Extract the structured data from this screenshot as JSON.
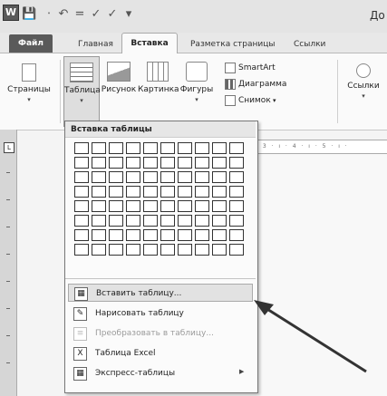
{
  "title_bar": {
    "app_logo": "W",
    "doc_title": "До"
  },
  "tabs": {
    "file": "Файл",
    "home": "Главная",
    "insert": "Вставка",
    "page_layout": "Разметка страницы",
    "references": "Ссылки"
  },
  "ribbon": {
    "pages": "Страницы",
    "table": "Таблица",
    "picture": "Рисунок",
    "clipart": "Картинка",
    "shapes": "Фигуры",
    "smartart": "SmartArt",
    "chart": "Диаграмма",
    "screenshot": "Снимок",
    "links": "Ссылки"
  },
  "table_menu": {
    "header": "Вставка таблицы",
    "grid": {
      "columns": 10,
      "rows": 8
    },
    "items": [
      {
        "label": "Вставить таблицу...",
        "icon": "insert-table-icon",
        "enabled": true,
        "highlighted": true
      },
      {
        "label": "Нарисовать таблицу",
        "icon": "draw-table-icon",
        "enabled": true
      },
      {
        "label": "Преобразовать в таблицу...",
        "icon": "convert-text-icon",
        "enabled": false
      },
      {
        "label": "Таблица Excel",
        "icon": "excel-table-icon",
        "enabled": true
      },
      {
        "label": "Экспресс-таблицы",
        "icon": "quick-tables-icon",
        "enabled": true,
        "submenu": true
      }
    ]
  },
  "ruler": {
    "marks": "· 3 · ı · 4 · ı · 5 · ı ·"
  }
}
